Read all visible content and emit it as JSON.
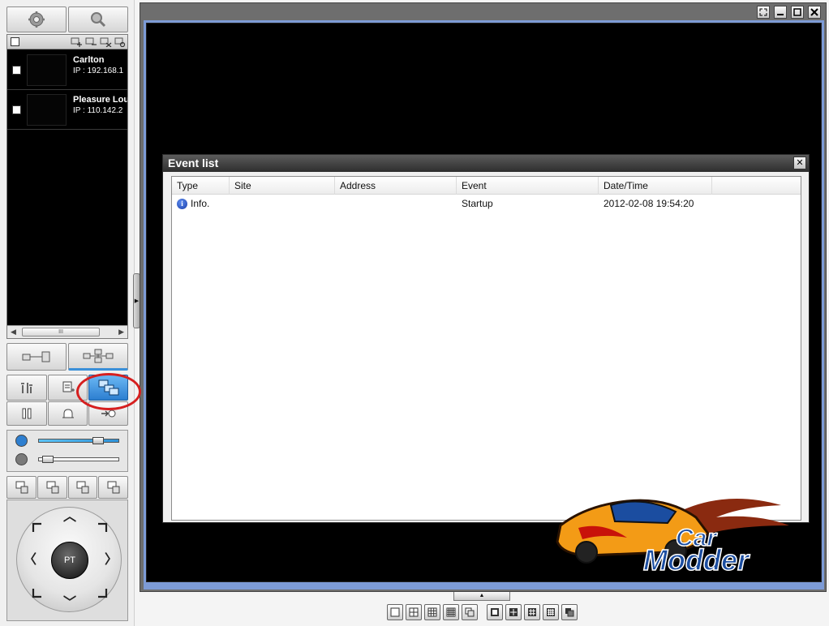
{
  "toolbar_top": {
    "settings_icon": "gear-icon",
    "search_icon": "magnifier-icon"
  },
  "site_list": {
    "sites": [
      {
        "name": "Carlton",
        "ip": "IP : 192.168.1"
      },
      {
        "name": "Pleasure Lou",
        "ip": "IP : 110.142.2"
      }
    ],
    "scroll_thumb_label": "III"
  },
  "ptz": {
    "center_label": "PT"
  },
  "sliders": {
    "volume_level": 0.78,
    "zoom_level": 0.06
  },
  "dialog": {
    "title": "Event list",
    "close_label": "✕",
    "columns": [
      "Type",
      "Site",
      "Address",
      "Event",
      "Date/Time"
    ],
    "rows": [
      {
        "type": "Info.",
        "site": "",
        "address": "",
        "event": "Startup",
        "datetime": "2012-02-08 19:54:20"
      }
    ]
  },
  "logo": {
    "line1": "Car",
    "line2": "Modder"
  },
  "colors": {
    "highlight": "#d61f1f",
    "viewport_border": "#7d9bd6",
    "active_button": "#3a8fd8"
  }
}
